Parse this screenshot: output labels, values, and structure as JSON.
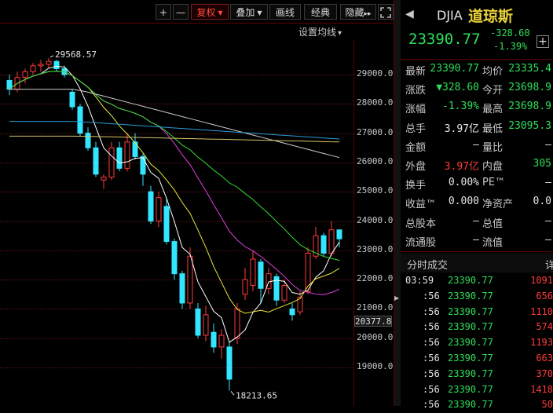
{
  "toolbar": {
    "plus": "+",
    "minus": "—",
    "restore_label": "复权",
    "overlay_label": "叠加",
    "draw_label": "画线",
    "classic_label": "经典",
    "hide_label": "隐藏",
    "hide_arrows": "▸▸",
    "fullscreen_icon": "fullscreen-icon"
  },
  "chart": {
    "ma_settings_label": "设置均线",
    "current_price_tag": "20377.8",
    "high_label": "29568.57",
    "low_label": "18213.65",
    "axis_ticks": [
      "29000.0",
      "28000.0",
      "27000.0",
      "26000.0",
      "25000.0",
      "24000.0",
      "23000.0",
      "22000.0",
      "21000.0",
      "20000.0",
      "19000.0"
    ],
    "colors": {
      "up": "#ff3b3b",
      "down": "#33e6ff",
      "ma5": "#ffffff",
      "ma10": "#e8e83a",
      "ma20": "#e040e0",
      "ma30": "#33dd33",
      "ma60": "#cccccc",
      "ma120": "#2a9ad8",
      "ma250": "#d8c46a"
    }
  },
  "chart_data": {
    "type": "candlestick",
    "title": "",
    "ylim": [
      18000,
      30000
    ],
    "candles": [
      {
        "o": 28800,
        "c": 28500,
        "h": 29000,
        "l": 28300
      },
      {
        "o": 28500,
        "c": 28900,
        "h": 29100,
        "l": 28400
      },
      {
        "o": 28900,
        "c": 29100,
        "h": 29200,
        "l": 28700
      },
      {
        "o": 29100,
        "c": 29300,
        "h": 29400,
        "l": 29000
      },
      {
        "o": 29300,
        "c": 29350,
        "h": 29500,
        "l": 29100
      },
      {
        "o": 29350,
        "c": 29450,
        "h": 29568.57,
        "l": 29200
      },
      {
        "o": 29450,
        "c": 29200,
        "h": 29500,
        "l": 29100
      },
      {
        "o": 29200,
        "c": 29000,
        "h": 29300,
        "l": 28900
      },
      {
        "o": 28400,
        "c": 27900,
        "h": 28500,
        "l": 27800
      },
      {
        "o": 27900,
        "c": 27000,
        "h": 28000,
        "l": 26900
      },
      {
        "o": 27000,
        "c": 26500,
        "h": 27200,
        "l": 26400
      },
      {
        "o": 26500,
        "c": 25600,
        "h": 26700,
        "l": 25500
      },
      {
        "o": 25400,
        "c": 25500,
        "h": 25600,
        "l": 25100
      },
      {
        "o": 25500,
        "c": 26500,
        "h": 26700,
        "l": 25400
      },
      {
        "o": 26500,
        "c": 25800,
        "h": 26700,
        "l": 25700
      },
      {
        "o": 25800,
        "c": 26700,
        "h": 27000,
        "l": 25700
      },
      {
        "o": 26700,
        "c": 26200,
        "h": 27000,
        "l": 26100
      },
      {
        "o": 26200,
        "c": 25600,
        "h": 26300,
        "l": 25200
      },
      {
        "o": 25000,
        "c": 24000,
        "h": 25200,
        "l": 23900
      },
      {
        "o": 24000,
        "c": 24800,
        "h": 25000,
        "l": 23800
      },
      {
        "o": 24500,
        "c": 23300,
        "h": 24800,
        "l": 23200
      },
      {
        "o": 23300,
        "c": 22200,
        "h": 23400,
        "l": 22000
      },
      {
        "o": 22200,
        "c": 21200,
        "h": 22300,
        "l": 21000
      },
      {
        "o": 21200,
        "c": 22800,
        "h": 23100,
        "l": 21000
      },
      {
        "o": 21000,
        "c": 20100,
        "h": 21200,
        "l": 20000
      },
      {
        "o": 20100,
        "c": 20800,
        "h": 21100,
        "l": 19900
      },
      {
        "o": 20200,
        "c": 19700,
        "h": 20500,
        "l": 19500
      },
      {
        "o": 19700,
        "c": 20100,
        "h": 20300,
        "l": 19300
      },
      {
        "o": 19700,
        "c": 18600,
        "h": 19900,
        "l": 18213.65
      },
      {
        "o": 20000,
        "c": 21000,
        "h": 21200,
        "l": 19800
      },
      {
        "o": 21500,
        "c": 22000,
        "h": 22400,
        "l": 21300
      },
      {
        "o": 21800,
        "c": 22700,
        "h": 23000,
        "l": 21600
      },
      {
        "o": 22600,
        "c": 21700,
        "h": 22700,
        "l": 21200
      },
      {
        "o": 21700,
        "c": 22200,
        "h": 22400,
        "l": 21500
      },
      {
        "o": 22100,
        "c": 21300,
        "h": 22200,
        "l": 21100
      },
      {
        "o": 21300,
        "c": 21800,
        "h": 22000,
        "l": 21200
      },
      {
        "o": 21000,
        "c": 20800,
        "h": 21200,
        "l": 20600
      },
      {
        "o": 20900,
        "c": 21400,
        "h": 21600,
        "l": 20800
      },
      {
        "o": 21600,
        "c": 22900,
        "h": 23100,
        "l": 21500
      },
      {
        "o": 22800,
        "c": 23500,
        "h": 23800,
        "l": 22700
      },
      {
        "o": 23500,
        "c": 22900,
        "h": 23600,
        "l": 22800
      },
      {
        "o": 22900,
        "c": 23700,
        "h": 24000,
        "l": 22800
      },
      {
        "o": 23698.98,
        "c": 23390.77,
        "h": 23698.98,
        "l": 23095.3
      }
    ]
  },
  "quote": {
    "symbol": "DJIA",
    "name": "道琼斯",
    "price": "23390.77",
    "change": "-328.60",
    "change_pct": "-1.39%",
    "plus_icon": "+"
  },
  "stats": [
    {
      "l1": "最新",
      "v1": "23390.77",
      "c1": "green",
      "l2": "均价",
      "v2": "23335.4",
      "c2": "green"
    },
    {
      "l1": "涨跌",
      "v1": "▼328.60",
      "c1": "green",
      "l2": "今开",
      "v2": "23698.9",
      "c2": "green"
    },
    {
      "l1": "涨幅",
      "v1": "-1.39%",
      "c1": "green",
      "l2": "最高",
      "v2": "23698.9",
      "c2": "green"
    },
    {
      "l1": "总手",
      "v1": "3.97亿",
      "c1": "white",
      "l2": "最低",
      "v2": "23095.3",
      "c2": "green"
    },
    {
      "l1": "金额",
      "v1": "—",
      "c1": "white",
      "l2": "量比",
      "v2": "—",
      "c2": "white"
    },
    {
      "l1": "外盘",
      "v1": "3.97亿",
      "c1": "red",
      "l2": "内盘",
      "v2": "305",
      "c2": "green"
    },
    {
      "l1": "换手",
      "v1": "0.00%",
      "c1": "white",
      "l2": "PE™",
      "v2": "—",
      "c2": "white"
    },
    {
      "l1": "收益™",
      "v1": "0.000",
      "c1": "white",
      "l2": "净资产",
      "v2": "0.0",
      "c2": "white"
    },
    {
      "l1": "总股本",
      "v1": "—",
      "c1": "white",
      "l2": "总值",
      "v2": "—",
      "c2": "white"
    },
    {
      "l1": "流通股",
      "v1": "—",
      "c1": "white",
      "l2": "流值",
      "v2": "—",
      "c2": "white"
    }
  ],
  "ticks": {
    "header": "分时成交",
    "header_right": "详",
    "rows": [
      {
        "t": "03:59",
        "p": "23390.77",
        "v": "1091"
      },
      {
        "t": ":56",
        "p": "23390.77",
        "v": "656"
      },
      {
        "t": ":56",
        "p": "23390.77",
        "v": "1110"
      },
      {
        "t": ":56",
        "p": "23390.77",
        "v": "574"
      },
      {
        "t": ":56",
        "p": "23390.77",
        "v": "1193"
      },
      {
        "t": ":56",
        "p": "23390.77",
        "v": "663"
      },
      {
        "t": ":56",
        "p": "23390.77",
        "v": "370"
      },
      {
        "t": ":56",
        "p": "23390.77",
        "v": "1418"
      },
      {
        "t": ":56",
        "p": "23390.77",
        "v": "50"
      }
    ]
  }
}
